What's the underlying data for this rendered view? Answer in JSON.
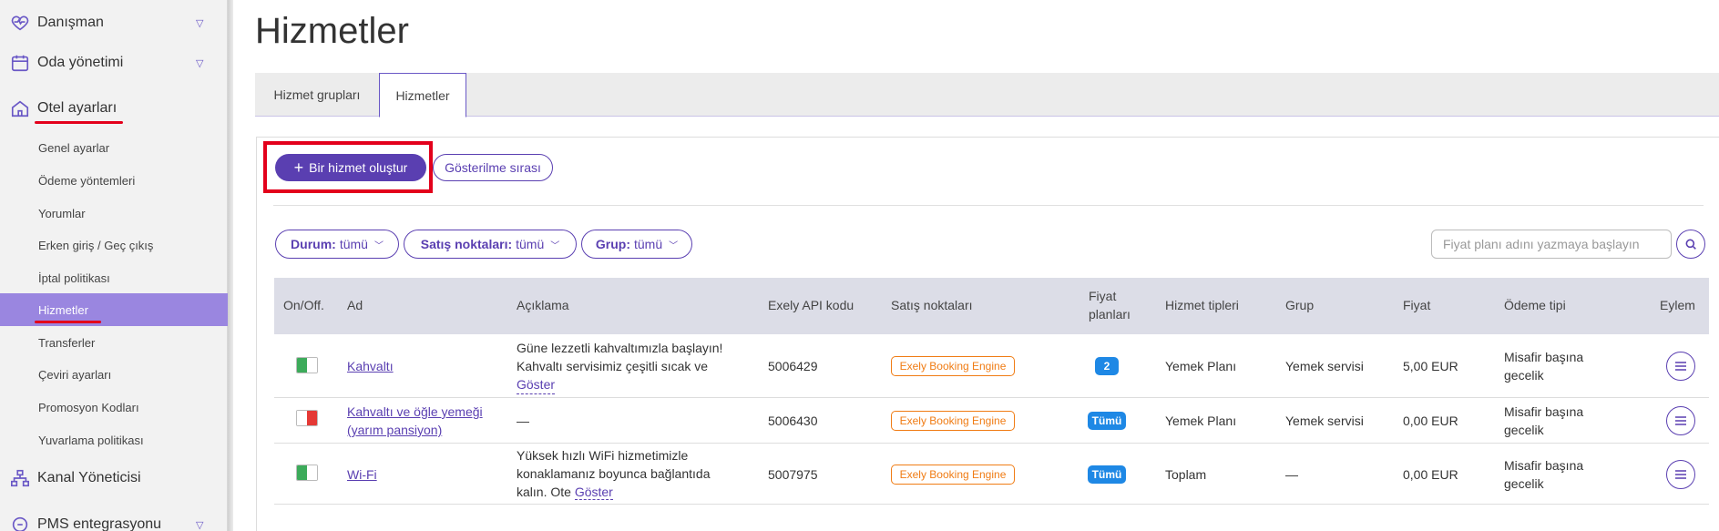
{
  "sidebar": {
    "items": [
      {
        "label": "Danışman",
        "icon": "heart-pulse-icon",
        "expandable": true
      },
      {
        "label": "Oda yönetimi",
        "icon": "calendar-icon",
        "expandable": true
      },
      {
        "label": "Otel ayarları",
        "icon": "home-icon",
        "expandable": false
      },
      {
        "label": "Kanal Yöneticisi",
        "icon": "network-icon",
        "expandable": false
      },
      {
        "label": "PMS entegrasyonu",
        "icon": "link-icon",
        "expandable": true
      }
    ],
    "sub_items": [
      {
        "label": "Genel ayarlar",
        "active": false
      },
      {
        "label": "Ödeme yöntemleri",
        "active": false
      },
      {
        "label": "Yorumlar",
        "active": false
      },
      {
        "label": "Erken giriş / Geç çıkış",
        "active": false
      },
      {
        "label": "İptal politikası",
        "active": false
      },
      {
        "label": "Hizmetler",
        "active": true
      },
      {
        "label": "Transferler",
        "active": false
      },
      {
        "label": "Çeviri ayarları",
        "active": false
      },
      {
        "label": "Promosyon Kodları",
        "active": false
      },
      {
        "label": "Yuvarlama politikası",
        "active": false
      }
    ]
  },
  "page": {
    "title": "Hizmetler"
  },
  "tabs": [
    {
      "label": "Hizmet grupları",
      "active": false
    },
    {
      "label": "Hizmetler",
      "active": true
    }
  ],
  "toolbar": {
    "create_label": "Bir hizmet oluştur",
    "order_label": "Gösterilme sırası"
  },
  "filters": [
    {
      "name": "Durum:",
      "value": "tümü"
    },
    {
      "name": "Satış noktaları:",
      "value": "tümü"
    },
    {
      "name": "Grup:",
      "value": "tümü"
    }
  ],
  "search": {
    "placeholder": "Fiyat planı adını yazmaya başlayın"
  },
  "table": {
    "headers": {
      "onoff": "On/Off.",
      "name": "Ad",
      "description": "Açıklama",
      "api": "Exely API kodu",
      "sales": "Satış noktaları",
      "price_plans_1": "Fiyat",
      "price_plans_2": "planları",
      "service_types": "Hizmet tipleri",
      "group": "Grup",
      "price": "Fiyat",
      "payment": "Ödeme tipi",
      "action": "Eylem"
    },
    "rows": [
      {
        "enabled": true,
        "name_1": "Kahvaltı",
        "name_2": "",
        "desc_1": "Güne lezzetli kahvaltımızla başlayın!",
        "desc_2": "Kahvaltı servisimiz çeşitli sıcak ve",
        "desc_3_text": "",
        "desc_show": "Göster",
        "api": "5006429",
        "sales": "Exely Booking Engine",
        "plans": "2",
        "type": "Yemek Planı",
        "group": "Yemek servisi",
        "price": "5,00 EUR",
        "pay_1": "Misafir başına",
        "pay_2": "gecelik"
      },
      {
        "enabled": false,
        "name_1": "Kahvaltı ve öğle yemeği",
        "name_2": "(yarım pansiyon)",
        "desc_1": "—",
        "desc_2": "",
        "desc_3_text": "",
        "desc_show": "",
        "api": "5006430",
        "sales": "Exely Booking Engine",
        "plans": "Tümü",
        "type": "Yemek Planı",
        "group": "Yemek servisi",
        "price": "0,00 EUR",
        "pay_1": "Misafir başına",
        "pay_2": "gecelik"
      },
      {
        "enabled": true,
        "name_1": "Wi-Fi",
        "name_2": "",
        "desc_1": "Yüksek hızlı WiFi hizmetimizle",
        "desc_2": "konaklamanız boyunca bağlantıda",
        "desc_3_text": "kalın. Ote",
        "desc_show": "Göster",
        "api": "5007975",
        "sales": "Exely Booking Engine",
        "plans": "Tümü",
        "type": "Toplam",
        "group": "—",
        "price": "0,00 EUR",
        "pay_1": "Misafir başına",
        "pay_2": "gecelik"
      }
    ]
  },
  "colors": {
    "accent": "#5a3fb1",
    "highlight": "#e3001b",
    "active_sub": "#9a86e0",
    "on": "#3cab5a",
    "off": "#e53935",
    "badge": "#1e88e5",
    "tag": "#f07c14"
  }
}
